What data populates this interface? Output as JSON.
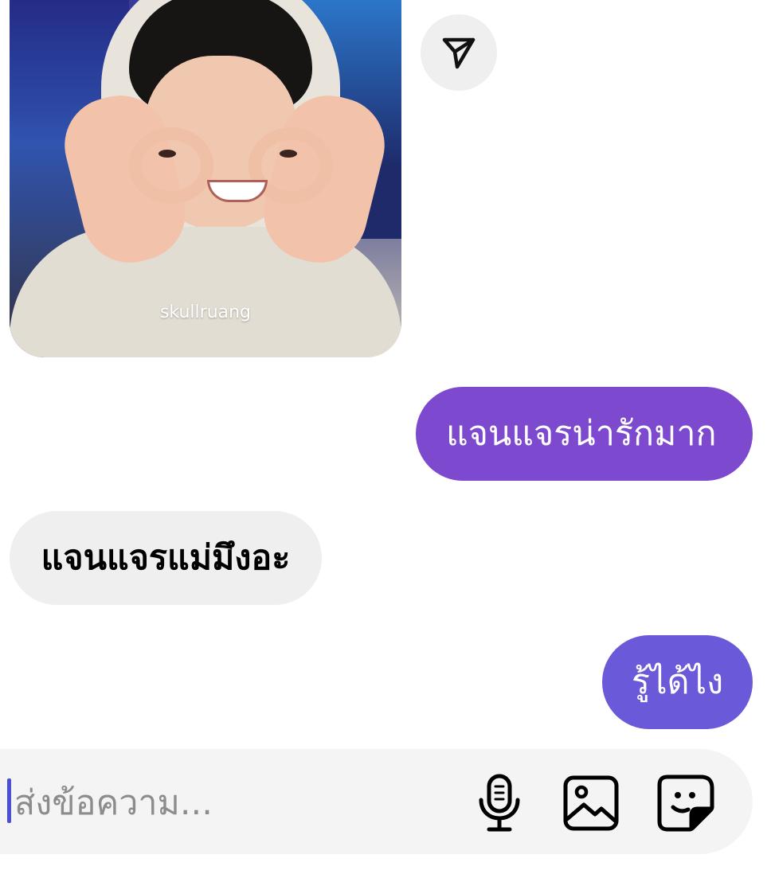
{
  "shared_post": {
    "watermark": "skullruang"
  },
  "conversation": {
    "messages": [
      {
        "direction": "sent",
        "text": "แจนแจรน่ารักมาก"
      },
      {
        "direction": "received",
        "text": "แจนแจรแม่มึงอะ"
      },
      {
        "direction": "sent",
        "text": "รู้ได้ไง"
      }
    ]
  },
  "composer": {
    "placeholder": "ส่งข้อความ...",
    "value": ""
  },
  "icons": {
    "share": "paper-plane-icon",
    "mic": "microphone-icon",
    "gallery": "photo-gallery-icon",
    "sticker": "sticker-icon"
  },
  "colors": {
    "sent_bubble_top": "#7c49cf",
    "sent_bubble_bottom": "#6a59d8",
    "received_bubble": "#efefef",
    "composer_background": "#f4f4f5",
    "cursor": "#4a4fd6"
  }
}
